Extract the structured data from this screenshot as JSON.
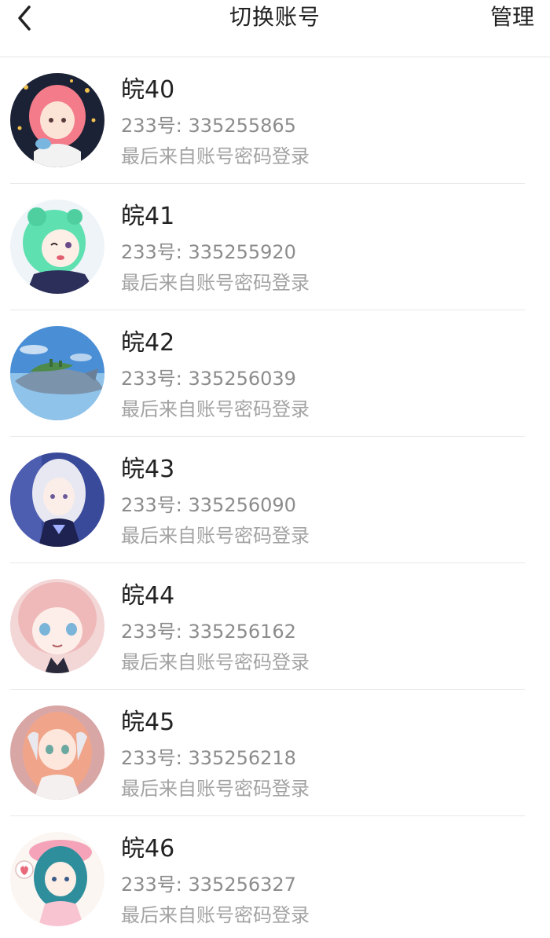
{
  "header": {
    "title": "切换账号",
    "manage_label": "管理",
    "back_icon": "chevron-left-icon"
  },
  "accounts": [
    {
      "name": "皖40",
      "id_text": "233号: 335255865",
      "login_text": "最后来自账号密码登录",
      "avatar": "anime-girl-pink-hair-avatar"
    },
    {
      "name": "皖41",
      "id_text": "233号: 335255920",
      "login_text": "最后来自账号密码登录",
      "avatar": "anime-girl-green-hair-avatar"
    },
    {
      "name": "皖42",
      "id_text": "233号: 335256039",
      "login_text": "最后来自账号密码登录",
      "avatar": "flying-whale-island-avatar"
    },
    {
      "name": "皖43",
      "id_text": "233号: 335256090",
      "login_text": "最后来自账号密码登录",
      "avatar": "anime-girl-silver-hair-avatar"
    },
    {
      "name": "皖44",
      "id_text": "233号: 335256162",
      "login_text": "最后来自账号密码登录",
      "avatar": "anime-girl-light-pink-hair-avatar"
    },
    {
      "name": "皖45",
      "id_text": "233号: 335256218",
      "login_text": "最后来自账号密码登录",
      "avatar": "anime-girl-orange-hair-avatar"
    },
    {
      "name": "皖46",
      "id_text": "233号: 335256327",
      "login_text": "最后来自账号密码登录",
      "avatar": "anime-girl-teal-hair-hat-avatar"
    }
  ]
}
